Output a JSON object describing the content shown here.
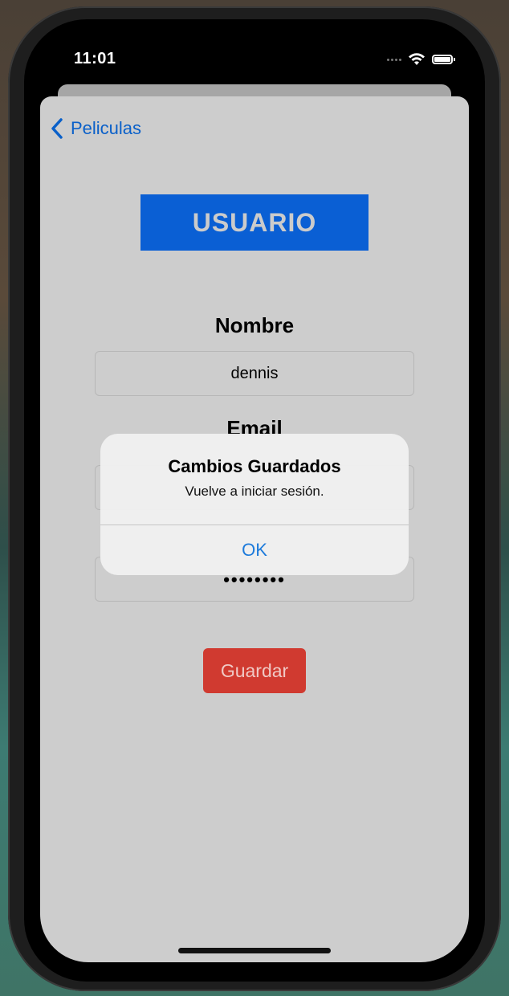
{
  "status_bar": {
    "time": "11:01",
    "signal_icon": "signal-dots-icon",
    "wifi_icon": "wifi-icon",
    "battery_icon": "battery-icon"
  },
  "nav": {
    "back_label": "Peliculas",
    "back_icon": "chevron-left-icon"
  },
  "header": {
    "title": "USUARIO"
  },
  "form": {
    "name_label": "Nombre",
    "name_value": "dennis",
    "email_label": "Email",
    "password_value": "••••••••",
    "save_label": "Guardar"
  },
  "alert": {
    "title": "Cambios Guardados",
    "message": "Vuelve a iniciar sesión.",
    "ok_label": "OK"
  },
  "colors": {
    "accent_blue": "#0a60c9",
    "header_blue": "#0a5fd4",
    "save_red": "#d03a30",
    "sheet_bg": "#cdcdcd"
  }
}
